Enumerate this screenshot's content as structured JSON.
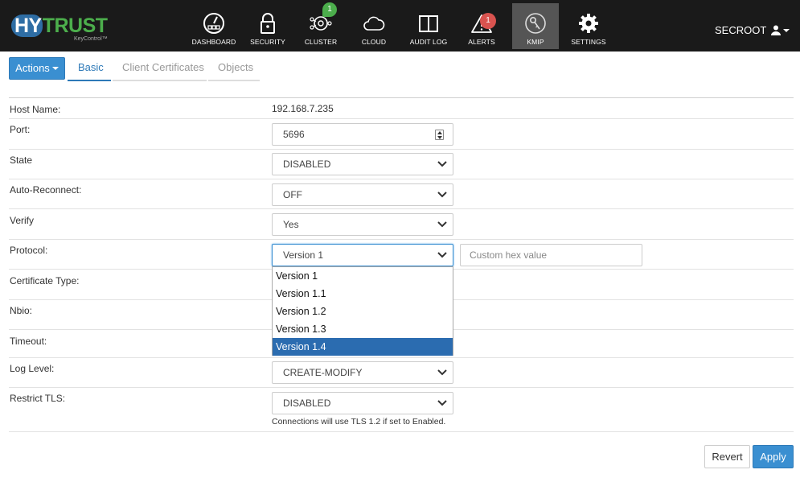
{
  "brand": {
    "name_part1": "HY",
    "name_part2": "TRUST",
    "subtitle": "KeyControl™"
  },
  "nav": {
    "items": [
      {
        "label": "DASHBOARD",
        "icon": "dashboard-gauge-icon"
      },
      {
        "label": "SECURITY",
        "icon": "lock-icon"
      },
      {
        "label": "CLUSTER",
        "icon": "cluster-icon",
        "badge": "1",
        "badge_color": "#4cae4c"
      },
      {
        "label": "CLOUD",
        "icon": "cloud-icon"
      },
      {
        "label": "AUDIT LOG",
        "icon": "book-icon"
      },
      {
        "label": "ALERTS",
        "icon": "warning-icon",
        "badge": "1",
        "badge_color": "#d9534f"
      },
      {
        "label": "KMIP",
        "icon": "key-icon",
        "active": true
      },
      {
        "label": "SETTINGS",
        "icon": "gear-icon"
      }
    ],
    "user": "SECROOT"
  },
  "toolbar": {
    "actions_label": "Actions",
    "tabs": [
      {
        "label": "Basic",
        "active": true
      },
      {
        "label": "Client Certificates"
      },
      {
        "label": "Objects"
      }
    ]
  },
  "form": {
    "host_name": {
      "label": "Host Name:",
      "value": "192.168.7.235"
    },
    "port": {
      "label": "Port:",
      "value": "5696"
    },
    "state": {
      "label": "State",
      "value": "DISABLED"
    },
    "auto_reconnect": {
      "label": "Auto-Reconnect:",
      "value": "OFF"
    },
    "verify": {
      "label": "Verify",
      "value": "Yes"
    },
    "protocol": {
      "label": "Protocol:",
      "value": "Version 1",
      "hex_placeholder": "Custom hex value",
      "options": [
        "Version 1",
        "Version 1.1",
        "Version 1.2",
        "Version 1.3",
        "Version 1.4"
      ],
      "highlighted": "Version 1.4"
    },
    "certificate_type": {
      "label": "Certificate Type:"
    },
    "nbio": {
      "label": "Nbio:"
    },
    "timeout": {
      "label": "Timeout:"
    },
    "log_level": {
      "label": "Log Level:",
      "value": "CREATE-MODIFY"
    },
    "restrict_tls": {
      "label": "Restrict TLS:",
      "value": "DISABLED",
      "help": "Connections will use TLS 1.2 if set to Enabled."
    }
  },
  "buttons": {
    "revert": "Revert",
    "apply": "Apply"
  },
  "colors": {
    "accent": "#3a8fd1",
    "topbar": "#1a1a1a",
    "selected_option": "#2b6cb0"
  }
}
